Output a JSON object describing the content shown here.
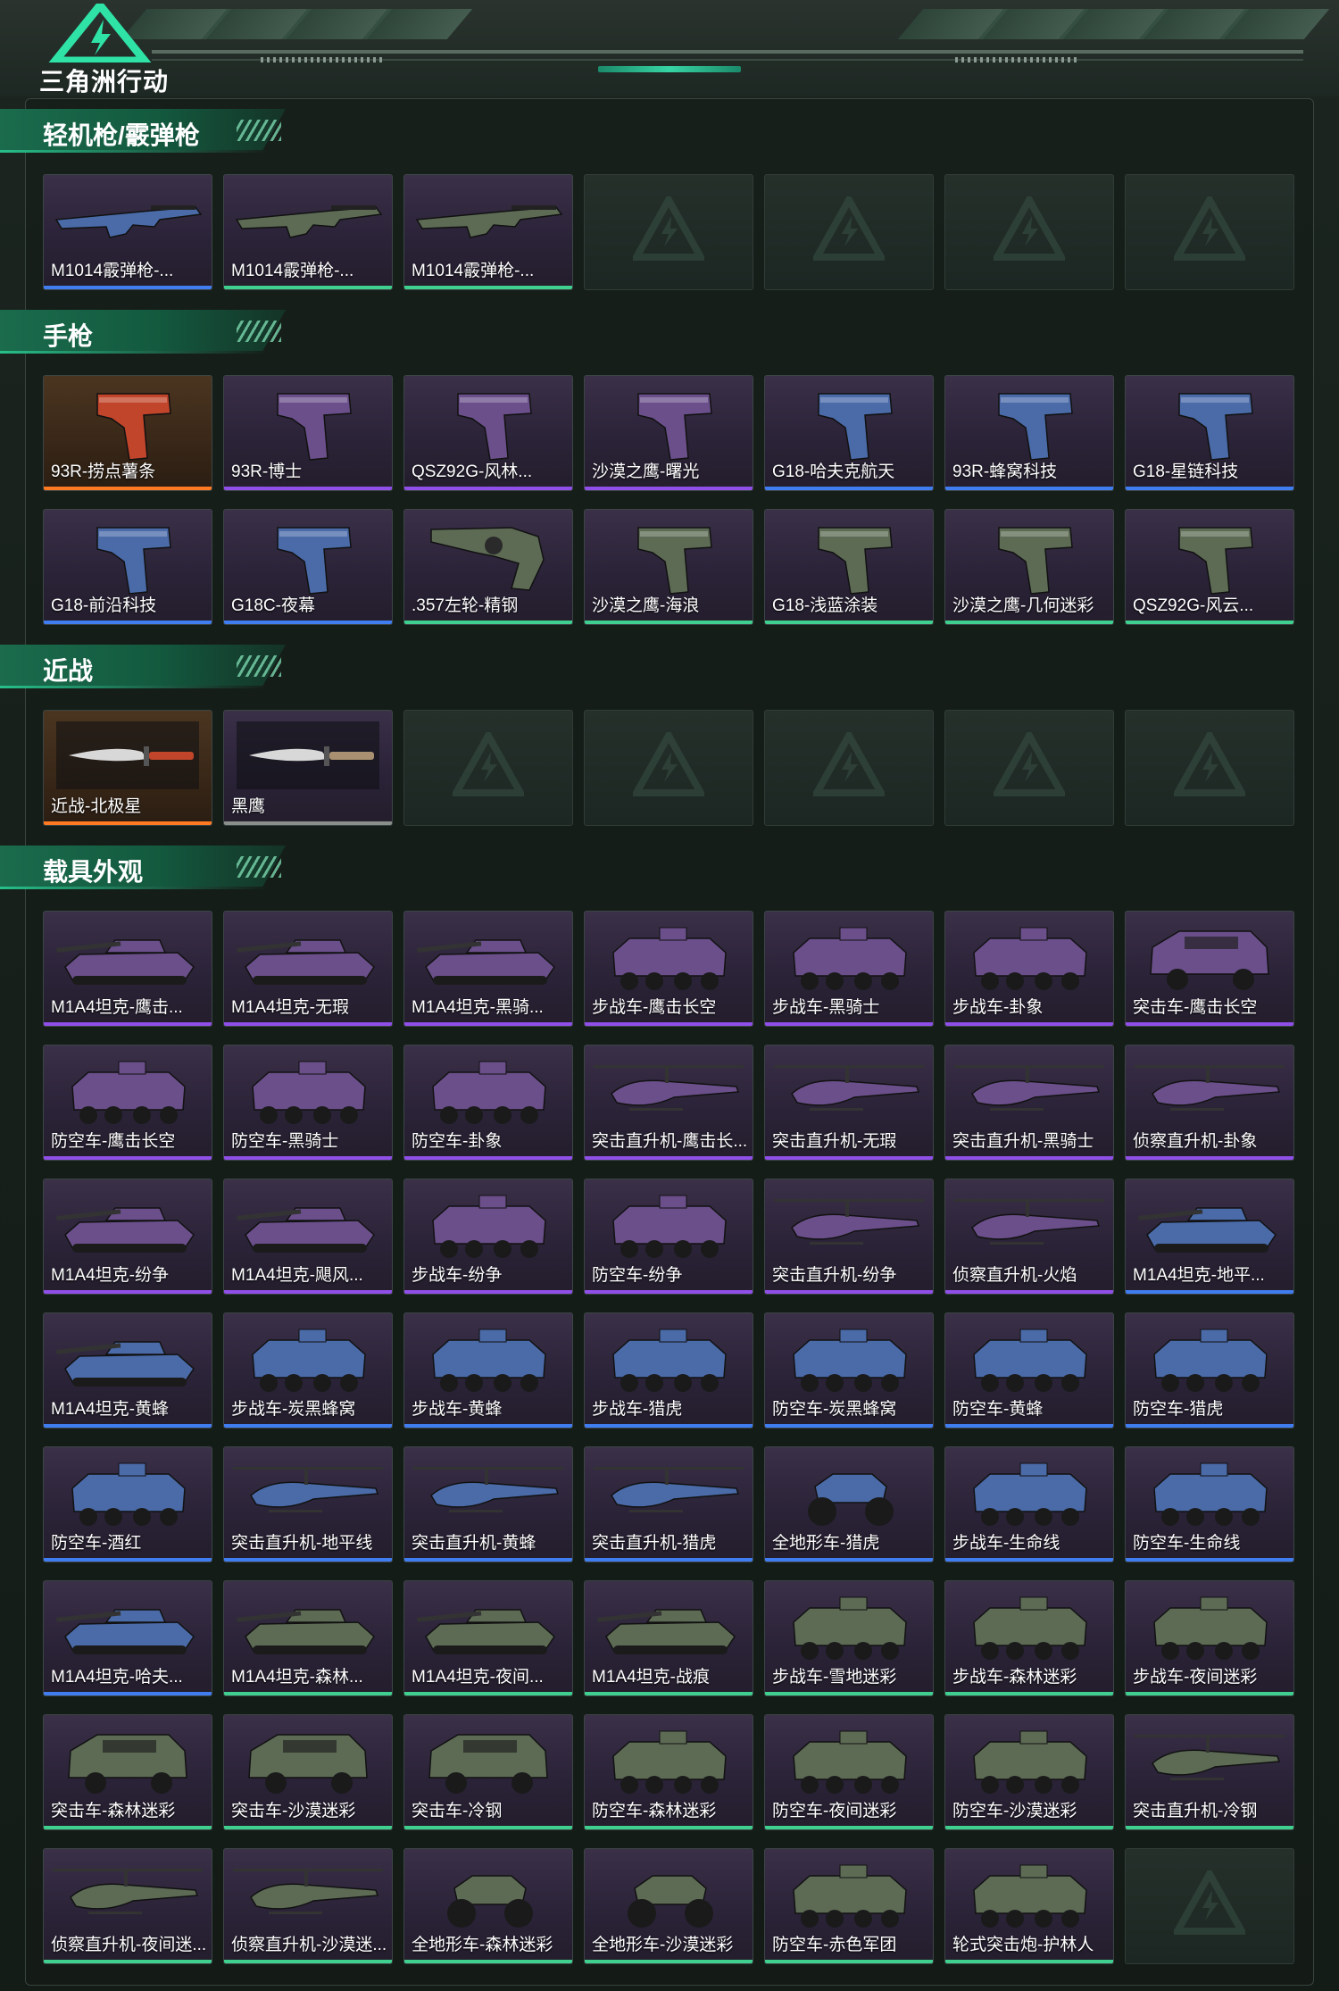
{
  "logo": {
    "text": "三角洲行动",
    "icon": "delta-logo-icon"
  },
  "colors": {
    "blue": "#3f7df0",
    "purple": "#8f4fe8",
    "green": "#3fcf8e",
    "orange": "#ff7a22",
    "accent": "#27c08a"
  },
  "sections": [
    {
      "title": "轻机枪/霰弹枪",
      "rows": [
        [
          {
            "label": "M1014霰弹枪-...",
            "rarity": "blue",
            "kind": "shotgun"
          },
          {
            "label": "M1014霰弹枪-...",
            "rarity": "green",
            "kind": "shotgun"
          },
          {
            "label": "M1014霰弹枪-...",
            "rarity": "green",
            "kind": "shotgun"
          },
          {
            "empty": true
          },
          {
            "empty": true
          },
          {
            "empty": true
          },
          {
            "empty": true
          }
        ]
      ]
    },
    {
      "title": "手枪",
      "rows": [
        [
          {
            "label": "93R-捞点薯条",
            "rarity": "orange",
            "kind": "pistol"
          },
          {
            "label": "93R-博士",
            "rarity": "purple",
            "kind": "pistol"
          },
          {
            "label": "QSZ92G-风林...",
            "rarity": "purple",
            "kind": "pistol"
          },
          {
            "label": "沙漠之鹰-曙光",
            "rarity": "purple",
            "kind": "pistol"
          },
          {
            "label": "G18-哈夫克航天",
            "rarity": "blue",
            "kind": "pistol"
          },
          {
            "label": "93R-蜂窝科技",
            "rarity": "blue",
            "kind": "pistol"
          },
          {
            "label": "G18-星链科技",
            "rarity": "blue",
            "kind": "pistol"
          }
        ],
        [
          {
            "label": "G18-前沿科技",
            "rarity": "blue",
            "kind": "pistol"
          },
          {
            "label": "G18C-夜幕",
            "rarity": "blue",
            "kind": "pistol"
          },
          {
            "label": ".357左轮-精钢",
            "rarity": "green",
            "kind": "revolver"
          },
          {
            "label": "沙漠之鹰-海浪",
            "rarity": "green",
            "kind": "pistol"
          },
          {
            "label": "G18-浅蓝涂装",
            "rarity": "green",
            "kind": "pistol"
          },
          {
            "label": "沙漠之鹰-几何迷彩",
            "rarity": "green",
            "kind": "pistol"
          },
          {
            "label": "QSZ92G-风云...",
            "rarity": "green",
            "kind": "pistol"
          }
        ]
      ]
    },
    {
      "title": "近战",
      "rows": [
        [
          {
            "label": "近战-北极星",
            "rarity": "orange",
            "kind": "knife"
          },
          {
            "label": "黑鹰",
            "rarity": "gray",
            "kind": "knife"
          },
          {
            "empty": true
          },
          {
            "empty": true
          },
          {
            "empty": true
          },
          {
            "empty": true
          },
          {
            "empty": true
          }
        ]
      ]
    },
    {
      "title": "载具外观",
      "rows": [
        [
          {
            "label": "M1A4坦克-鹰击...",
            "rarity": "purple",
            "kind": "tank"
          },
          {
            "label": "M1A4坦克-无瑕",
            "rarity": "purple",
            "kind": "tank"
          },
          {
            "label": "M1A4坦克-黑骑...",
            "rarity": "purple",
            "kind": "tank"
          },
          {
            "label": "步战车-鹰击长空",
            "rarity": "purple",
            "kind": "ifv"
          },
          {
            "label": "步战车-黑骑士",
            "rarity": "purple",
            "kind": "ifv"
          },
          {
            "label": "步战车-卦象",
            "rarity": "purple",
            "kind": "ifv"
          },
          {
            "label": "突击车-鹰击长空",
            "rarity": "purple",
            "kind": "truck"
          }
        ],
        [
          {
            "label": "防空车-鹰击长空",
            "rarity": "purple",
            "kind": "ifv"
          },
          {
            "label": "防空车-黑骑士",
            "rarity": "purple",
            "kind": "ifv"
          },
          {
            "label": "防空车-卦象",
            "rarity": "purple",
            "kind": "ifv"
          },
          {
            "label": "突击直升机-鹰击长...",
            "rarity": "purple",
            "kind": "heli"
          },
          {
            "label": "突击直升机-无瑕",
            "rarity": "purple",
            "kind": "heli"
          },
          {
            "label": "突击直升机-黑骑士",
            "rarity": "purple",
            "kind": "heli"
          },
          {
            "label": "侦察直升机-卦象",
            "rarity": "purple",
            "kind": "heli"
          }
        ],
        [
          {
            "label": "M1A4坦克-纷争",
            "rarity": "purple",
            "kind": "tank"
          },
          {
            "label": "M1A4坦克-飓风...",
            "rarity": "purple",
            "kind": "tank"
          },
          {
            "label": "步战车-纷争",
            "rarity": "purple",
            "kind": "ifv"
          },
          {
            "label": "防空车-纷争",
            "rarity": "purple",
            "kind": "ifv"
          },
          {
            "label": "突击直升机-纷争",
            "rarity": "purple",
            "kind": "heli"
          },
          {
            "label": "侦察直升机-火焰",
            "rarity": "purple",
            "kind": "heli"
          },
          {
            "label": "M1A4坦克-地平...",
            "rarity": "blue",
            "kind": "tank"
          }
        ],
        [
          {
            "label": "M1A4坦克-黄蜂",
            "rarity": "blue",
            "kind": "tank"
          },
          {
            "label": "步战车-炭黑蜂窝",
            "rarity": "blue",
            "kind": "ifv"
          },
          {
            "label": "步战车-黄蜂",
            "rarity": "blue",
            "kind": "ifv"
          },
          {
            "label": "步战车-猎虎",
            "rarity": "blue",
            "kind": "ifv"
          },
          {
            "label": "防空车-炭黑蜂窝",
            "rarity": "blue",
            "kind": "ifv"
          },
          {
            "label": "防空车-黄蜂",
            "rarity": "blue",
            "kind": "ifv"
          },
          {
            "label": "防空车-猎虎",
            "rarity": "blue",
            "kind": "ifv"
          }
        ],
        [
          {
            "label": "防空车-酒红",
            "rarity": "blue",
            "kind": "ifv"
          },
          {
            "label": "突击直升机-地平线",
            "rarity": "blue",
            "kind": "heli"
          },
          {
            "label": "突击直升机-黄蜂",
            "rarity": "blue",
            "kind": "heli"
          },
          {
            "label": "突击直升机-猎虎",
            "rarity": "blue",
            "kind": "heli"
          },
          {
            "label": "全地形车-猎虎",
            "rarity": "blue",
            "kind": "atv"
          },
          {
            "label": "步战车-生命线",
            "rarity": "blue",
            "kind": "ifv"
          },
          {
            "label": "防空车-生命线",
            "rarity": "blue",
            "kind": "ifv"
          }
        ],
        [
          {
            "label": "M1A4坦克-哈夫...",
            "rarity": "blue",
            "kind": "tank"
          },
          {
            "label": "M1A4坦克-森林...",
            "rarity": "green",
            "kind": "tank"
          },
          {
            "label": "M1A4坦克-夜间...",
            "rarity": "green",
            "kind": "tank"
          },
          {
            "label": "M1A4坦克-战痕",
            "rarity": "green",
            "kind": "tank"
          },
          {
            "label": "步战车-雪地迷彩",
            "rarity": "green",
            "kind": "ifv"
          },
          {
            "label": "步战车-森林迷彩",
            "rarity": "green",
            "kind": "ifv"
          },
          {
            "label": "步战车-夜间迷彩",
            "rarity": "green",
            "kind": "ifv"
          }
        ],
        [
          {
            "label": "突击车-森林迷彩",
            "rarity": "green",
            "kind": "truck"
          },
          {
            "label": "突击车-沙漠迷彩",
            "rarity": "green",
            "kind": "truck"
          },
          {
            "label": "突击车-冷钢",
            "rarity": "green",
            "kind": "truck"
          },
          {
            "label": "防空车-森林迷彩",
            "rarity": "green",
            "kind": "ifv"
          },
          {
            "label": "防空车-夜间迷彩",
            "rarity": "green",
            "kind": "ifv"
          },
          {
            "label": "防空车-沙漠迷彩",
            "rarity": "green",
            "kind": "ifv"
          },
          {
            "label": "突击直升机-冷钢",
            "rarity": "green",
            "kind": "heli"
          }
        ],
        [
          {
            "label": "侦察直升机-夜间迷...",
            "rarity": "green",
            "kind": "heli"
          },
          {
            "label": "侦察直升机-沙漠迷...",
            "rarity": "green",
            "kind": "heli"
          },
          {
            "label": "全地形车-森林迷彩",
            "rarity": "green",
            "kind": "atv"
          },
          {
            "label": "全地形车-沙漠迷彩",
            "rarity": "green",
            "kind": "atv"
          },
          {
            "label": "防空车-赤色军团",
            "rarity": "green",
            "kind": "ifv"
          },
          {
            "label": "轮式突击炮-护林人",
            "rarity": "green",
            "kind": "ifv"
          },
          {
            "empty": true
          }
        ]
      ]
    }
  ]
}
